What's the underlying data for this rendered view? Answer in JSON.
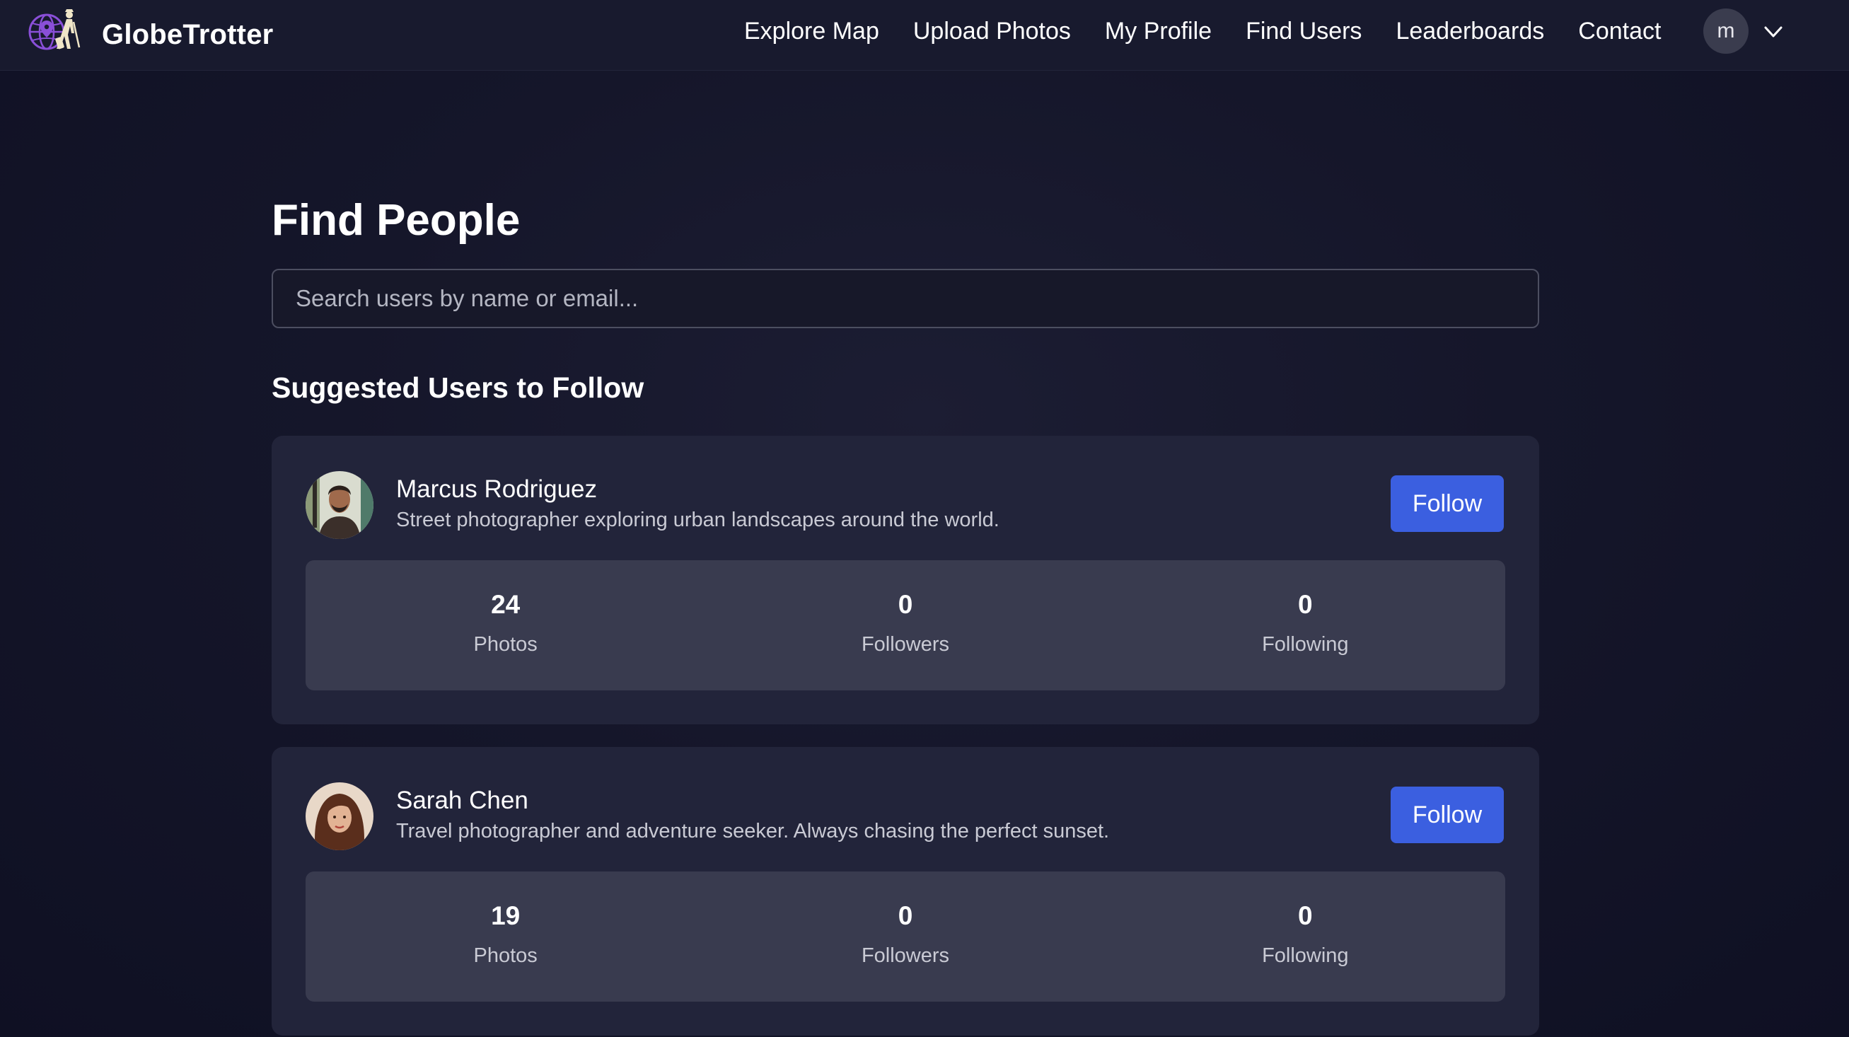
{
  "brand": {
    "name": "GlobeTrotter",
    "logo_icon": "globe-traveler-icon"
  },
  "nav": {
    "links": [
      "Explore Map",
      "Upload Photos",
      "My Profile",
      "Find Users",
      "Leaderboards",
      "Contact"
    ],
    "avatar_initial": "m",
    "dropdown_icon": "chevron-down-icon"
  },
  "page": {
    "title": "Find People",
    "search_placeholder": "Search users by name or email...",
    "section_title": "Suggested Users to Follow"
  },
  "users": [
    {
      "name": "Marcus Rodriguez",
      "bio": "Street photographer exploring urban landscapes around the world.",
      "follow_label": "Follow",
      "stats": [
        {
          "value": "24",
          "label": "Photos"
        },
        {
          "value": "0",
          "label": "Followers"
        },
        {
          "value": "0",
          "label": "Following"
        }
      ]
    },
    {
      "name": "Sarah Chen",
      "bio": "Travel photographer and adventure seeker. Always chasing the perfect sunset.",
      "follow_label": "Follow",
      "stats": [
        {
          "value": "19",
          "label": "Photos"
        },
        {
          "value": "0",
          "label": "Followers"
        },
        {
          "value": "0",
          "label": "Following"
        }
      ]
    }
  ],
  "colors": {
    "background": "#15162a",
    "navbar": "#181a2e",
    "card": "#22243a",
    "stats_panel": "#393b4f",
    "accent_button": "#3b5fe0",
    "logo_accent": "#8a4fd8"
  }
}
